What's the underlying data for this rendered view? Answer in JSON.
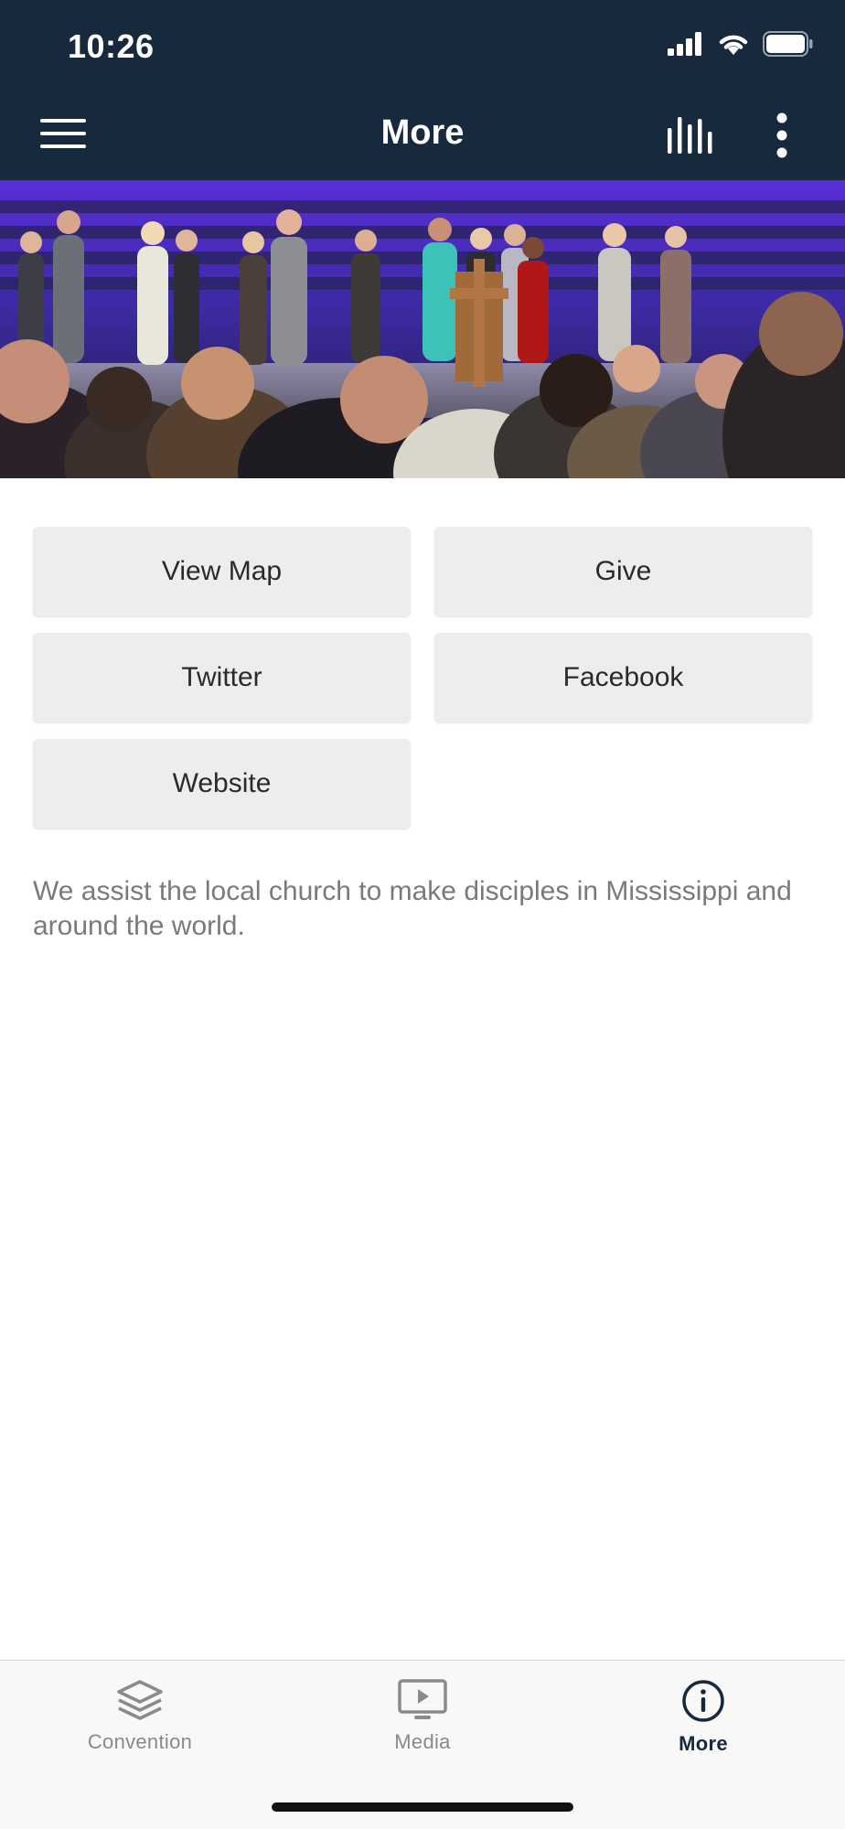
{
  "status_bar": {
    "time": "10:26"
  },
  "header": {
    "title": "More",
    "menu_icon": "hamburger-menu-icon",
    "stats_icon": "audio-bars-icon",
    "overflow_icon": "more-vertical-icon",
    "background_color": "#172a3d"
  },
  "hero": {
    "description_icon": "worship-service-photo"
  },
  "buttons": [
    {
      "label": "View Map"
    },
    {
      "label": "Give"
    },
    {
      "label": "Twitter"
    },
    {
      "label": "Facebook"
    },
    {
      "label": "Website"
    }
  ],
  "description": "We assist the local church to make disciples in Mississippi and around the world.",
  "tabs": [
    {
      "label": "Convention",
      "icon": "layers-icon",
      "active": false
    },
    {
      "label": "Media",
      "icon": "play-screen-icon",
      "active": false
    },
    {
      "label": "More",
      "icon": "info-circle-icon",
      "active": true
    }
  ],
  "colors": {
    "accent": "#172a3d",
    "tile": "#ecedee",
    "muted_text": "#7a7a7a"
  }
}
